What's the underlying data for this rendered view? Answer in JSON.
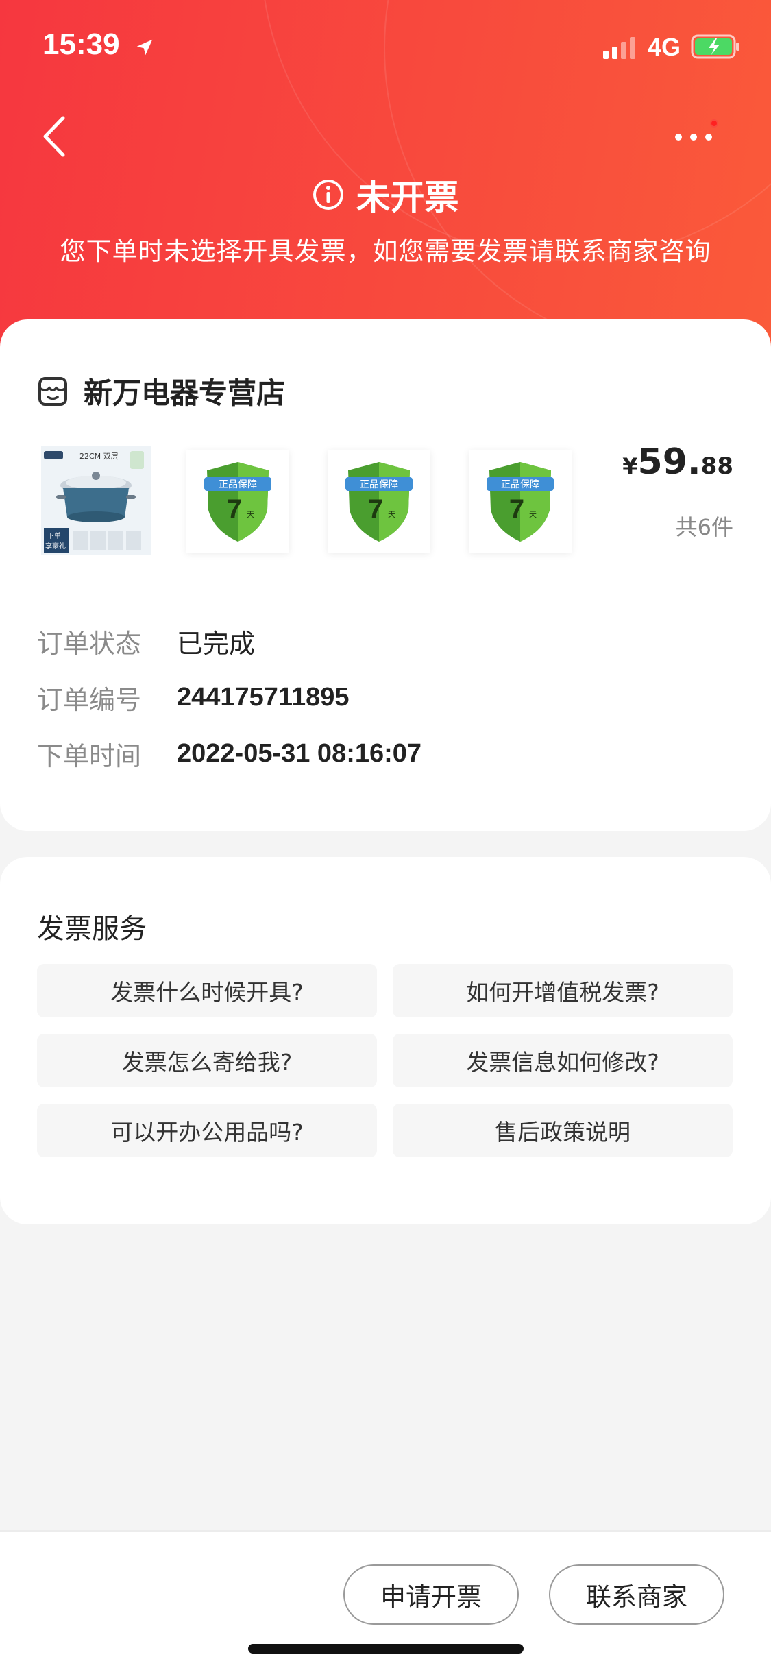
{
  "status_bar": {
    "time": "15:39",
    "network": "4G"
  },
  "header": {
    "title": "未开票",
    "subtitle": "您下单时未选择开具发票，如您需要发票请联系商家咨询",
    "accent_color": "#f6373f"
  },
  "order": {
    "shop_name": "新万电器专营店",
    "products": [
      {
        "icon": "rice-cooker-pot-image",
        "badge": "22CM 双层",
        "caption_top": "下单",
        "caption_bottom": "享豪礼"
      },
      {
        "icon": "shield-guarantee-image",
        "ribbon": "正品保障",
        "number": "7",
        "unit": "天"
      },
      {
        "icon": "shield-guarantee-image",
        "ribbon": "正品保障",
        "number": "7",
        "unit": "天"
      },
      {
        "icon": "shield-guarantee-image",
        "ribbon": "正品保障",
        "number": "7",
        "unit": "天"
      }
    ],
    "price": {
      "symbol": "¥",
      "integer": "59.",
      "decimal": "88"
    },
    "count": "共6件",
    "details": [
      {
        "label": "订单状态",
        "value": "已完成"
      },
      {
        "label": "订单编号",
        "value": "244175711895"
      },
      {
        "label": "下单时间",
        "value": "2022-05-31 08:16:07"
      }
    ]
  },
  "invoice_service": {
    "title": "发票服务",
    "questions": [
      "发票什么时候开具?",
      "如何开增值税发票?",
      "发票怎么寄给我?",
      "发票信息如何修改?",
      "可以开办公用品吗?",
      "售后政策说明"
    ]
  },
  "bottom_bar": {
    "apply_invoice": "申请开票",
    "contact_merchant": "联系商家"
  }
}
